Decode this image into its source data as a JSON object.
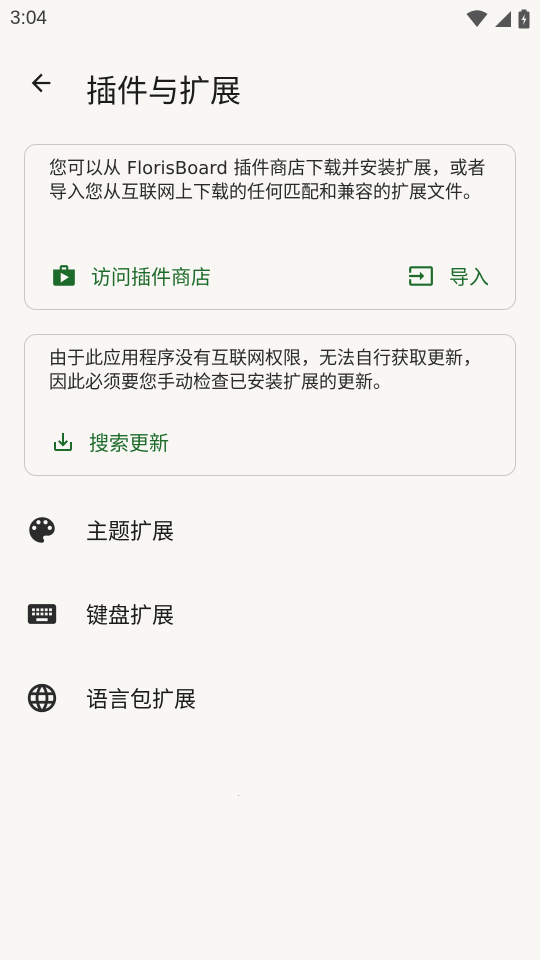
{
  "status_bar": {
    "time": "3:04",
    "icons": [
      "wifi-icon",
      "cellular-signal-icon",
      "battery-charging-icon"
    ]
  },
  "app_bar": {
    "back_icon": "arrow-back-icon",
    "title": "插件与扩展"
  },
  "store_card": {
    "text": "您可以从 FlorisBoard 插件商店下载并安装扩展，或者导入您从互联网上下载的任何匹配和兼容的扩展文件。",
    "store_action": {
      "label": "访问插件商店",
      "icon": "store-bag-icon"
    },
    "import_action": {
      "label": "导入",
      "icon": "import-icon"
    }
  },
  "update_card": {
    "text": "由于此应用程序没有互联网权限，无法自行获取更新，因此必须要您手动检查已安装扩展的更新。",
    "search_action": {
      "label": "搜索更新",
      "icon": "download-icon"
    }
  },
  "extension_list": [
    {
      "label": "主题扩展",
      "icon": "palette-icon"
    },
    {
      "label": "键盘扩展",
      "icon": "keyboard-icon"
    },
    {
      "label": "语言包扩展",
      "icon": "globe-icon"
    }
  ],
  "colors": {
    "accent": "#1d6b2a",
    "background": "#f8f7f4",
    "card_border": "#c8c8c4",
    "text": "#1c1c1c"
  }
}
